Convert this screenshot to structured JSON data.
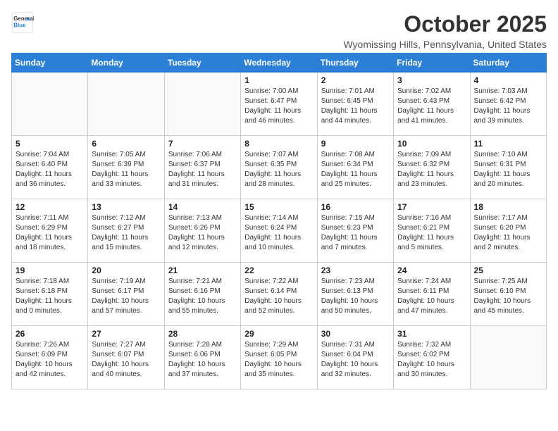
{
  "logo": {
    "line1": "General",
    "line2": "Blue"
  },
  "title": "October 2025",
  "subtitle": "Wyomissing Hills, Pennsylvania, United States",
  "weekdays": [
    "Sunday",
    "Monday",
    "Tuesday",
    "Wednesday",
    "Thursday",
    "Friday",
    "Saturday"
  ],
  "weeks": [
    [
      {
        "day": "",
        "info": ""
      },
      {
        "day": "",
        "info": ""
      },
      {
        "day": "",
        "info": ""
      },
      {
        "day": "1",
        "info": "Sunrise: 7:00 AM\nSunset: 6:47 PM\nDaylight: 11 hours\nand 46 minutes."
      },
      {
        "day": "2",
        "info": "Sunrise: 7:01 AM\nSunset: 6:45 PM\nDaylight: 11 hours\nand 44 minutes."
      },
      {
        "day": "3",
        "info": "Sunrise: 7:02 AM\nSunset: 6:43 PM\nDaylight: 11 hours\nand 41 minutes."
      },
      {
        "day": "4",
        "info": "Sunrise: 7:03 AM\nSunset: 6:42 PM\nDaylight: 11 hours\nand 39 minutes."
      }
    ],
    [
      {
        "day": "5",
        "info": "Sunrise: 7:04 AM\nSunset: 6:40 PM\nDaylight: 11 hours\nand 36 minutes."
      },
      {
        "day": "6",
        "info": "Sunrise: 7:05 AM\nSunset: 6:39 PM\nDaylight: 11 hours\nand 33 minutes."
      },
      {
        "day": "7",
        "info": "Sunrise: 7:06 AM\nSunset: 6:37 PM\nDaylight: 11 hours\nand 31 minutes."
      },
      {
        "day": "8",
        "info": "Sunrise: 7:07 AM\nSunset: 6:35 PM\nDaylight: 11 hours\nand 28 minutes."
      },
      {
        "day": "9",
        "info": "Sunrise: 7:08 AM\nSunset: 6:34 PM\nDaylight: 11 hours\nand 25 minutes."
      },
      {
        "day": "10",
        "info": "Sunrise: 7:09 AM\nSunset: 6:32 PM\nDaylight: 11 hours\nand 23 minutes."
      },
      {
        "day": "11",
        "info": "Sunrise: 7:10 AM\nSunset: 6:31 PM\nDaylight: 11 hours\nand 20 minutes."
      }
    ],
    [
      {
        "day": "12",
        "info": "Sunrise: 7:11 AM\nSunset: 6:29 PM\nDaylight: 11 hours\nand 18 minutes."
      },
      {
        "day": "13",
        "info": "Sunrise: 7:12 AM\nSunset: 6:27 PM\nDaylight: 11 hours\nand 15 minutes."
      },
      {
        "day": "14",
        "info": "Sunrise: 7:13 AM\nSunset: 6:26 PM\nDaylight: 11 hours\nand 12 minutes."
      },
      {
        "day": "15",
        "info": "Sunrise: 7:14 AM\nSunset: 6:24 PM\nDaylight: 11 hours\nand 10 minutes."
      },
      {
        "day": "16",
        "info": "Sunrise: 7:15 AM\nSunset: 6:23 PM\nDaylight: 11 hours\nand 7 minutes."
      },
      {
        "day": "17",
        "info": "Sunrise: 7:16 AM\nSunset: 6:21 PM\nDaylight: 11 hours\nand 5 minutes."
      },
      {
        "day": "18",
        "info": "Sunrise: 7:17 AM\nSunset: 6:20 PM\nDaylight: 11 hours\nand 2 minutes."
      }
    ],
    [
      {
        "day": "19",
        "info": "Sunrise: 7:18 AM\nSunset: 6:18 PM\nDaylight: 11 hours\nand 0 minutes."
      },
      {
        "day": "20",
        "info": "Sunrise: 7:19 AM\nSunset: 6:17 PM\nDaylight: 10 hours\nand 57 minutes."
      },
      {
        "day": "21",
        "info": "Sunrise: 7:21 AM\nSunset: 6:16 PM\nDaylight: 10 hours\nand 55 minutes."
      },
      {
        "day": "22",
        "info": "Sunrise: 7:22 AM\nSunset: 6:14 PM\nDaylight: 10 hours\nand 52 minutes."
      },
      {
        "day": "23",
        "info": "Sunrise: 7:23 AM\nSunset: 6:13 PM\nDaylight: 10 hours\nand 50 minutes."
      },
      {
        "day": "24",
        "info": "Sunrise: 7:24 AM\nSunset: 6:11 PM\nDaylight: 10 hours\nand 47 minutes."
      },
      {
        "day": "25",
        "info": "Sunrise: 7:25 AM\nSunset: 6:10 PM\nDaylight: 10 hours\nand 45 minutes."
      }
    ],
    [
      {
        "day": "26",
        "info": "Sunrise: 7:26 AM\nSunset: 6:09 PM\nDaylight: 10 hours\nand 42 minutes."
      },
      {
        "day": "27",
        "info": "Sunrise: 7:27 AM\nSunset: 6:07 PM\nDaylight: 10 hours\nand 40 minutes."
      },
      {
        "day": "28",
        "info": "Sunrise: 7:28 AM\nSunset: 6:06 PM\nDaylight: 10 hours\nand 37 minutes."
      },
      {
        "day": "29",
        "info": "Sunrise: 7:29 AM\nSunset: 6:05 PM\nDaylight: 10 hours\nand 35 minutes."
      },
      {
        "day": "30",
        "info": "Sunrise: 7:31 AM\nSunset: 6:04 PM\nDaylight: 10 hours\nand 32 minutes."
      },
      {
        "day": "31",
        "info": "Sunrise: 7:32 AM\nSunset: 6:02 PM\nDaylight: 10 hours\nand 30 minutes."
      },
      {
        "day": "",
        "info": ""
      }
    ]
  ]
}
